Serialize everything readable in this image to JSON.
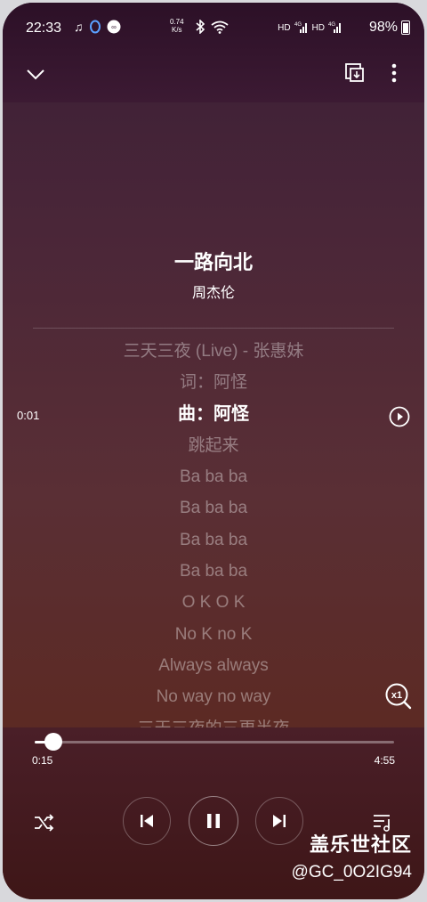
{
  "status_bar": {
    "time": "22:33",
    "net_speed_value": "0.74",
    "net_speed_unit": "K/s",
    "network_hd1": "HD",
    "network_4g1": "4G",
    "network_hd2": "HD",
    "network_4g2": "4G",
    "battery": "98%"
  },
  "player": {
    "song_title": "一路向北",
    "artist": "周杰伦",
    "lyric_timestamp": "0:01",
    "lyrics": [
      "三天三夜 (Live) - 张惠妹",
      "词：阿怪",
      "曲：阿怪",
      "跳起来",
      "Ba ba ba",
      "Ba ba ba",
      "Ba ba ba",
      "Ba ba ba",
      "O K O K",
      "No K no K",
      "Always always",
      "No way no way",
      "三天三夜的三更半夜"
    ],
    "active_lyric_index": 2,
    "speed_label": "x1",
    "position": "0:15",
    "duration": "4:55",
    "progress_fraction": 0.051
  },
  "icons": {
    "collapse": "chevron-down-icon",
    "cast": "cast-icon",
    "more": "more-vert-icon",
    "play_from_line": "play-circle-icon",
    "shuffle": "shuffle-icon",
    "previous": "skip-previous-icon",
    "pause": "pause-icon",
    "next": "skip-next-icon",
    "queue": "queue-music-icon"
  },
  "watermark": {
    "line1": "盖乐世社区",
    "line2": "@GC_0O2IG94"
  }
}
